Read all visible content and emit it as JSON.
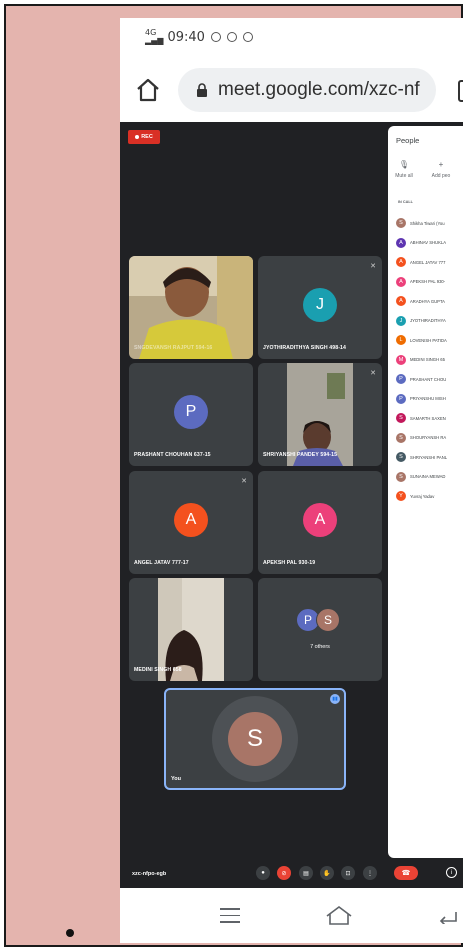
{
  "status_bar": {
    "network": "4G",
    "signal": "▂▄▆",
    "time": "09:40"
  },
  "browser": {
    "url": "meet.google.com/xzc-nf",
    "home_icon": "home-icon",
    "lock_icon": "lock-icon"
  },
  "meet": {
    "rec_label": "REC",
    "tiles": [
      {
        "name": "SNGDEVANSH RAJPUT 594-16",
        "type": "video"
      },
      {
        "name": "JYOTHIRADITHYA SINGH 498-14",
        "avatar": "J",
        "color": "#1a9fb0"
      },
      {
        "name": "PRASHANT CHOUHAN 637-15",
        "avatar": "P",
        "color": "#5c6bc0"
      },
      {
        "name": "SHRIYANSHI PANDEY 594-15",
        "type": "video"
      },
      {
        "name": "ANGEL JATAV 777-17",
        "avatar": "A",
        "color": "#f4511e"
      },
      {
        "name": "APEKSH PAL 930-19",
        "avatar": "A",
        "color": "#ec407a"
      },
      {
        "name": "MEDINI SINGH 658",
        "type": "video"
      }
    ],
    "others": {
      "avatars": [
        "P",
        "S"
      ],
      "label": "7 others"
    },
    "you": {
      "avatar": "S",
      "label": "You"
    },
    "people_panel": {
      "title": "People",
      "actions": [
        "Mute all",
        "Add peo"
      ],
      "section_label": "IN CALL",
      "participants": [
        {
          "initial": "S",
          "name": "Shikha Tiwari (You",
          "color": "#a87567"
        },
        {
          "initial": "A",
          "name": "ABHINAV SHUKLA",
          "color": "#5e35b1"
        },
        {
          "initial": "A",
          "name": "ANGEL JATAV 777",
          "color": "#f4511e"
        },
        {
          "initial": "A",
          "name": "APEKSH PAL 930-",
          "color": "#ec407a"
        },
        {
          "initial": "A",
          "name": "ARADHYA GUPTA",
          "color": "#f4511e"
        },
        {
          "initial": "J",
          "name": "JYOTHIRADITHYA",
          "color": "#1a9fb0"
        },
        {
          "initial": "L",
          "name": "LOVENISH PATIDA",
          "color": "#ef6c00"
        },
        {
          "initial": "M",
          "name": "MEDINI SINGH 65",
          "color": "#ec407a"
        },
        {
          "initial": "P",
          "name": "PRASHANT CHOU",
          "color": "#5c6bc0"
        },
        {
          "initial": "P",
          "name": "PRIYANSHU MISH",
          "color": "#5c6bc0"
        },
        {
          "initial": "S",
          "name": "SAMARTH SAXEN",
          "color": "#c2185b"
        },
        {
          "initial": "S",
          "name": "SHOURYANSH RA",
          "color": "#a87567"
        },
        {
          "initial": "S",
          "name": "SHRIYANSHI PANL",
          "color": "#455a64"
        },
        {
          "initial": "S",
          "name": "SUNAINA MEWAD",
          "color": "#a87567"
        },
        {
          "initial": "Y",
          "name": "Yuvraj Yadav",
          "color": "#f4511e"
        }
      ]
    },
    "meeting_code": "xzc-nfpo-egb"
  }
}
